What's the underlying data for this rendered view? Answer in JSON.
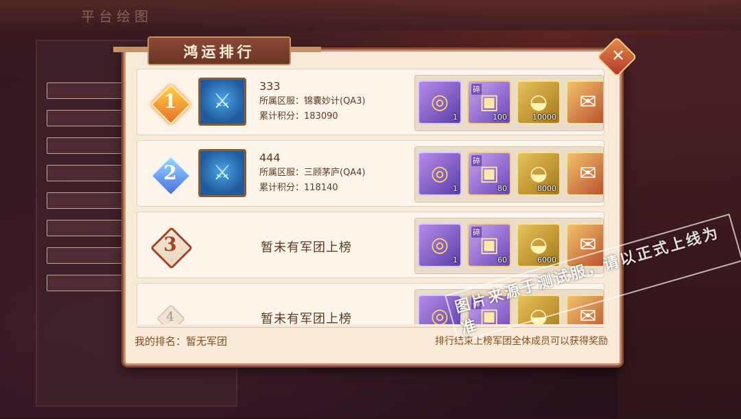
{
  "background": {
    "top_title": "平台绘图"
  },
  "dialog": {
    "title": "鸿运排行",
    "close_label": "✕",
    "my_rank": "我的排名：暂无军团",
    "note": "排行结束上榜军团全体成员可以获得奖励"
  },
  "rows": [
    {
      "rank": "1",
      "guild_name": "333",
      "server": "所属区服：锦囊妙计(QA3)",
      "score": "累计积分：183090",
      "rewards": [
        {
          "icon": "purple-orb-icon",
          "count": "1"
        },
        {
          "icon": "treasure-chest-icon",
          "tag": "碎",
          "count": "100"
        },
        {
          "icon": "gold-ingot-icon",
          "count": "10000"
        },
        {
          "icon": "red-envelope-icon",
          "count": ""
        }
      ]
    },
    {
      "rank": "2",
      "guild_name": "444",
      "server": "所属区服：三顾茅庐(QA4)",
      "score": "累计积分：118140",
      "rewards": [
        {
          "icon": "purple-orb-icon",
          "count": "1"
        },
        {
          "icon": "treasure-chest-icon",
          "tag": "碎",
          "count": "80"
        },
        {
          "icon": "gold-ingot-icon",
          "count": "8000"
        },
        {
          "icon": "red-envelope-icon",
          "count": ""
        }
      ]
    },
    {
      "rank": "3",
      "empty_text": "暂未有军团上榜",
      "rewards": [
        {
          "icon": "purple-orb-icon",
          "count": "1"
        },
        {
          "icon": "treasure-chest-icon",
          "tag": "碎",
          "count": "60"
        },
        {
          "icon": "gold-ingot-icon",
          "count": "6000"
        },
        {
          "icon": "red-envelope-icon",
          "count": ""
        }
      ]
    },
    {
      "rank": "4",
      "empty_text": "暂未有军团上榜",
      "rewards": [
        {
          "icon": "purple-orb-icon",
          "count": ""
        },
        {
          "icon": "treasure-chest-icon",
          "tag": "碎",
          "count": ""
        },
        {
          "icon": "gold-ingot-icon",
          "count": ""
        },
        {
          "icon": "red-envelope-icon",
          "count": ""
        }
      ]
    }
  ],
  "watermark": "图片来源于测试服，请以正式上线为准",
  "colors": {
    "panel": "#f7ead9",
    "accent": "#8b4a38",
    "text": "#5e3a24"
  }
}
